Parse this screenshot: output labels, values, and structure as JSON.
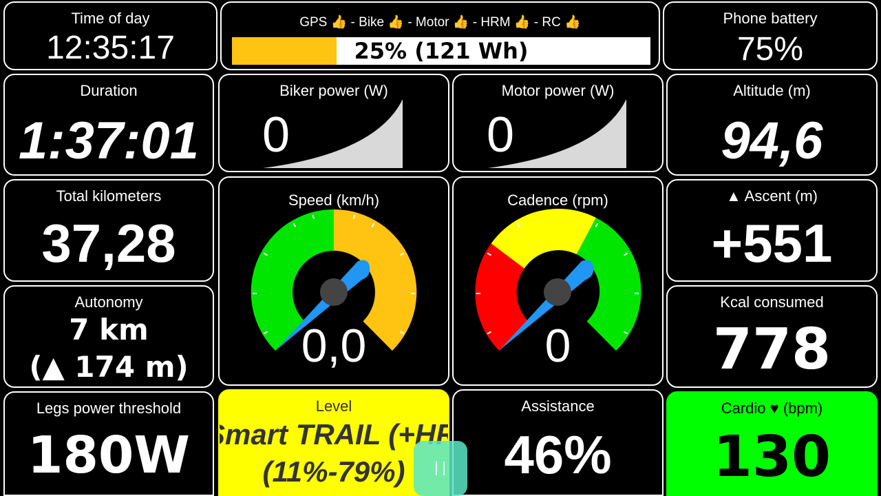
{
  "time_of_day": {
    "label": "Time of day",
    "value": "12:35:17"
  },
  "status": {
    "sensors": "GPS 👍 - Bike 👍 - Motor 👍 - HRM 👍 - RC 👍",
    "battery_fraction": 0.25,
    "battery_text": "25% (121 Wh)"
  },
  "phone_battery": {
    "label": "Phone battery",
    "value": "75%"
  },
  "duration": {
    "label": "Duration",
    "value": "1:37:01"
  },
  "biker_power": {
    "label": "Biker power (W)",
    "value": "0"
  },
  "motor_power": {
    "label": "Motor power (W)",
    "value": "0"
  },
  "altitude": {
    "label": "Altitude (m)",
    "value": "94,6"
  },
  "total_km": {
    "label": "Total kilometers",
    "value": "37,28"
  },
  "speed": {
    "label": "Speed (km/h)",
    "value": "0,0"
  },
  "cadence": {
    "label": "Cadence (rpm)",
    "value": "0"
  },
  "ascent": {
    "label": "▲ Ascent (m)",
    "value": "+551"
  },
  "autonomy": {
    "label": "Autonomy",
    "line1": "7 km",
    "line2": "(▲ 174 m)"
  },
  "kcal": {
    "label": "Kcal consumed",
    "value": "778"
  },
  "legs_power": {
    "label": "Legs power threshold",
    "value": "180W"
  },
  "level": {
    "label": "Level",
    "line1": "Smart TRAIL (+HR)",
    "line2": "(11%-79%)"
  },
  "assistance": {
    "label": "Assistance",
    "value": "46%"
  },
  "cardio": {
    "label": "Cardio ♥ (bpm)",
    "value": "130"
  },
  "colors": {
    "yellow": "#FFFF00",
    "green": "#00FF00",
    "gauge_orange": "#FFC312",
    "gauge_red": "#FF0000",
    "needle_blue": "#2196F3",
    "battery_fill": "#FFC312",
    "handle_teal": "#5CE6C5"
  }
}
